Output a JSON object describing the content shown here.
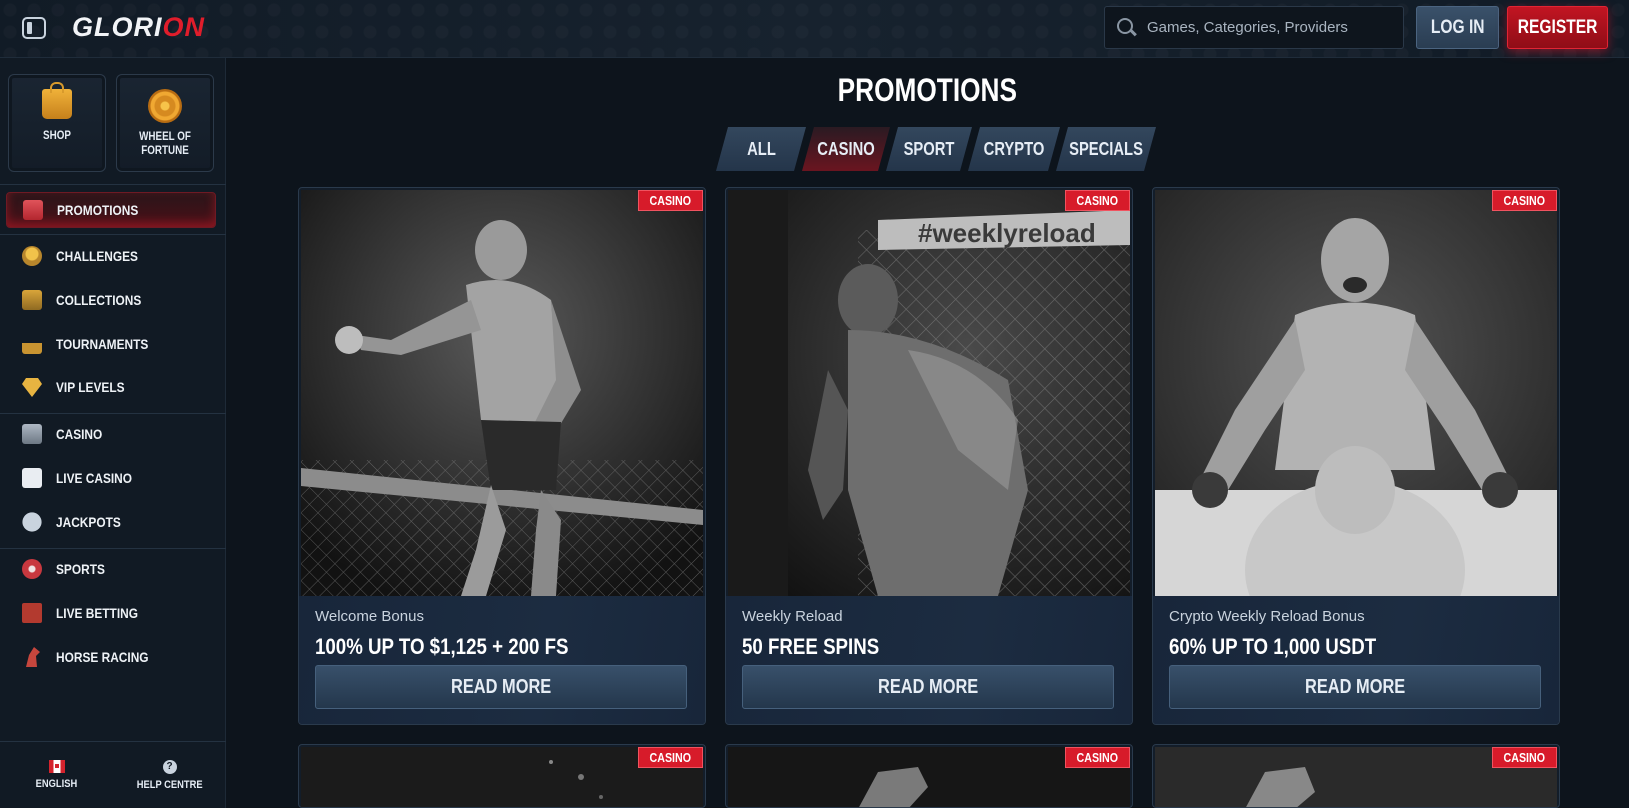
{
  "header": {
    "logo_left": "GLORI",
    "logo_right": "ON",
    "search_placeholder": "Games, Categories, Providers",
    "login_label": "LOG IN",
    "register_label": "REGISTER"
  },
  "sidebar": {
    "tiles": [
      {
        "label": "SHOP",
        "icon": "shopping-bag-icon"
      },
      {
        "label": "WHEEL OF FORTUNE",
        "icon": "wheel-icon"
      }
    ],
    "items": [
      {
        "label": "PROMOTIONS",
        "icon": "gift-icon",
        "active": true
      },
      {
        "label": "CHALLENGES",
        "icon": "award-icon"
      },
      {
        "label": "COLLECTIONS",
        "icon": "cards-icon"
      },
      {
        "label": "TOURNAMENTS",
        "icon": "podium-icon"
      },
      {
        "label": "VIP LEVELS",
        "icon": "diamond-icon"
      },
      {
        "label": "CASINO",
        "icon": "slot-machine-icon"
      },
      {
        "label": "LIVE CASINO",
        "icon": "playing-card-icon"
      },
      {
        "label": "JACKPOTS",
        "icon": "clover-icon"
      },
      {
        "label": "SPORTS",
        "icon": "ball-icon"
      },
      {
        "label": "LIVE BETTING",
        "icon": "live-icon"
      },
      {
        "label": "HORSE RACING",
        "icon": "horse-icon"
      }
    ],
    "footer": {
      "language": "ENGLISH",
      "help": "HELP CENTRE"
    }
  },
  "main": {
    "title": "PROMOTIONS",
    "tabs": [
      {
        "label": "ALL"
      },
      {
        "label": "CASINO",
        "active": true
      },
      {
        "label": "SPORT"
      },
      {
        "label": "CRYPTO"
      },
      {
        "label": "SPECIALS"
      }
    ],
    "cards": [
      {
        "badge": "CASINO",
        "subtitle": "Welcome Bonus",
        "title": "100% UP TO $1,125 + 200 FS",
        "button": "READ MORE"
      },
      {
        "badge": "CASINO",
        "subtitle": "Weekly Reload",
        "title": "50 FREE SPINS",
        "button": "READ MORE",
        "image_text": "#weeklyreload"
      },
      {
        "badge": "CASINO",
        "subtitle": "Crypto Weekly Reload Bonus",
        "title": "60% UP TO 1,000 USDT",
        "button": "READ MORE"
      },
      {
        "badge": "CASINO"
      },
      {
        "badge": "CASINO"
      },
      {
        "badge": "CASINO"
      }
    ]
  },
  "colors": {
    "accent_red": "#d71b2a",
    "background": "#0d141c",
    "panel": "#131d29"
  }
}
